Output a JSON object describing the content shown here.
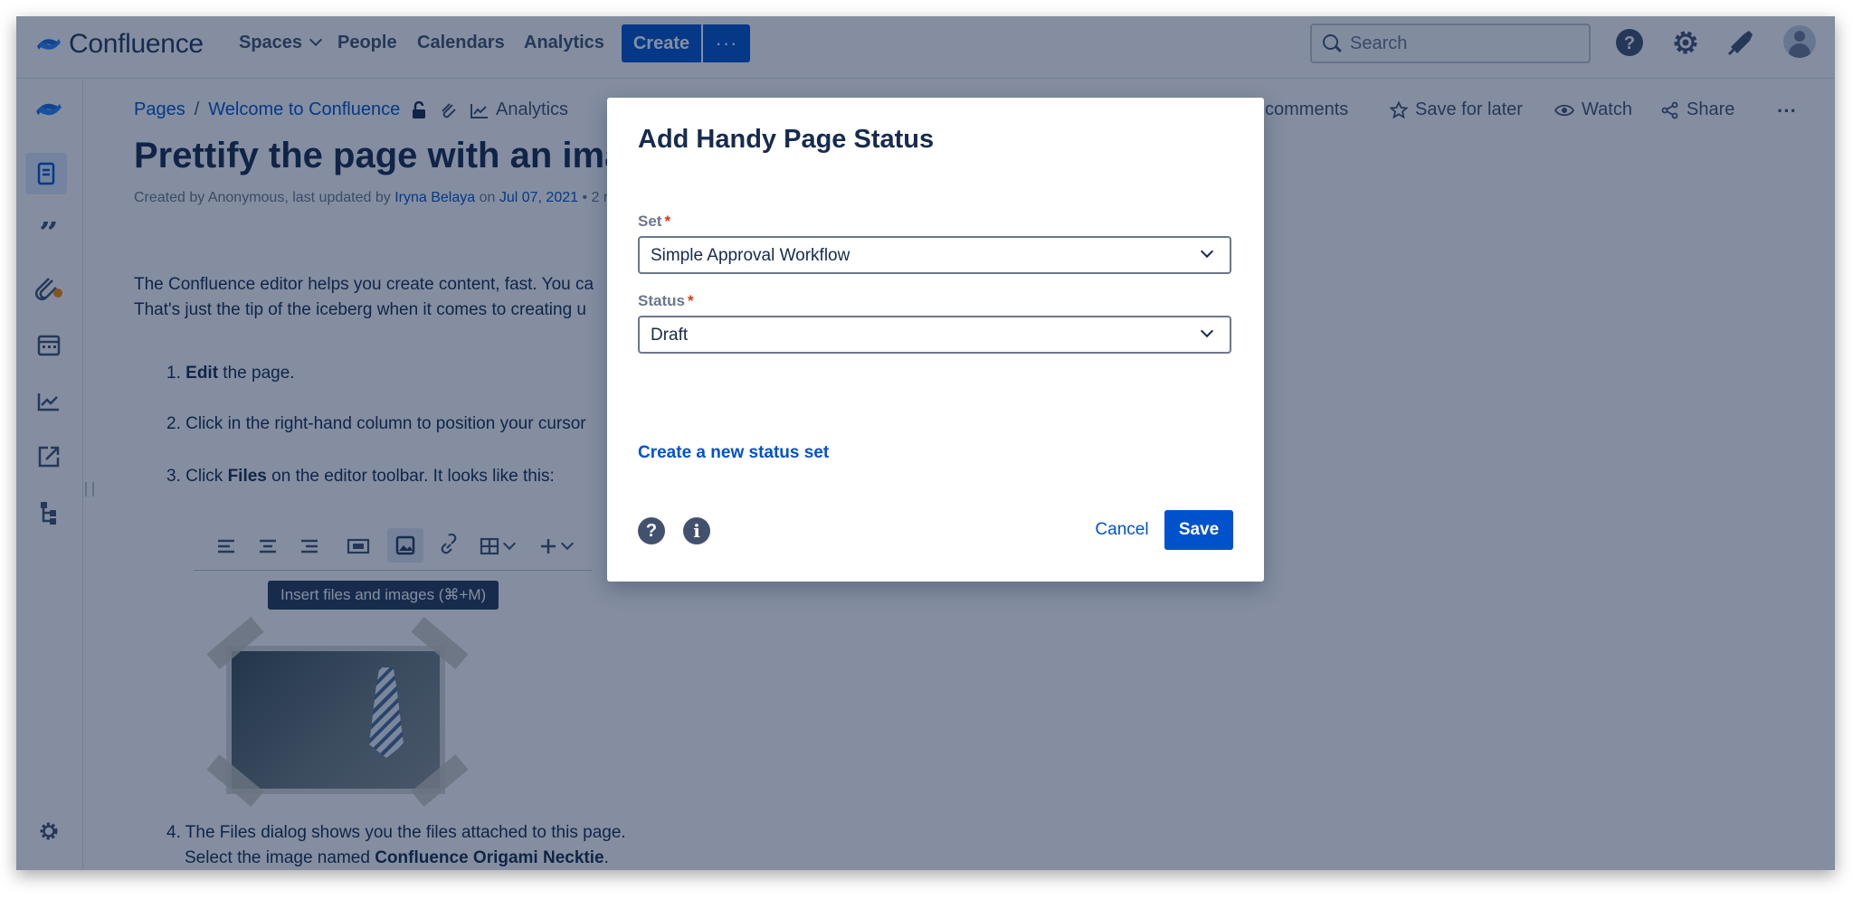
{
  "app": {
    "logo_text": "Confluence",
    "brand_color": "#0052cc"
  },
  "topnav": {
    "items": [
      "Spaces",
      "People",
      "Calendars",
      "Analytics"
    ],
    "create_label": "Create",
    "more_label": "···",
    "search_placeholder": "Search",
    "icons": [
      "help-icon",
      "settings-icon",
      "notifications-icon",
      "avatar"
    ]
  },
  "sidebar": {
    "icons": [
      "confluence-logo-icon",
      "pages-icon",
      "blogs-icon",
      "attachments-icon",
      "calendar-icon",
      "analytics-icon",
      "share-icon",
      "hierarchy-icon",
      "space-settings-icon"
    ]
  },
  "breadcrumb": {
    "items": [
      "Pages",
      "Welcome to Confluence"
    ],
    "analytics_label": "Analytics"
  },
  "page_actions": {
    "comments_label": "comments",
    "save_for_later_label": "Save for later",
    "watch_label": "Watch",
    "share_label": "Share"
  },
  "page": {
    "title": "Prettify the page with an imag",
    "byline_prefix": "Created by Anonymous, last updated by",
    "byline_author": "Iryna Belaya",
    "byline_on": "on",
    "byline_date": "Jul 07, 2021",
    "byline_suffix": "• 2 m",
    "intro_line1": "The Confluence editor helps you create content, fast. You ca",
    "intro_line2": "That's just the tip of the iceberg when it comes to creating u",
    "step1_num": "1.",
    "step1_bold": "Edit",
    "step1_rest": " the page.",
    "step2": "2. Click in the right-hand column to position your cursor",
    "step3_pre": "3. Click ",
    "step3_bold": "Files",
    "step3_rest": " on the editor toolbar. It looks like this:",
    "tooltip": "Insert files and images (⌘+M)",
    "step4_line1": "4. The Files dialog shows you the files attached to this page.",
    "step4_line2_pre": "Select the image named ",
    "step4_line2_bold": "Confluence Origami Necktie",
    "step4_line2_post": "."
  },
  "modal": {
    "title": "Add Handy Page Status",
    "set_label": "Set",
    "set_value": "Simple Approval Workflow",
    "status_label": "Status",
    "status_value": "Draft",
    "create_link": "Create a new status set",
    "help_glyph": "?",
    "info_glyph": "i",
    "cancel_label": "Cancel",
    "save_label": "Save"
  }
}
